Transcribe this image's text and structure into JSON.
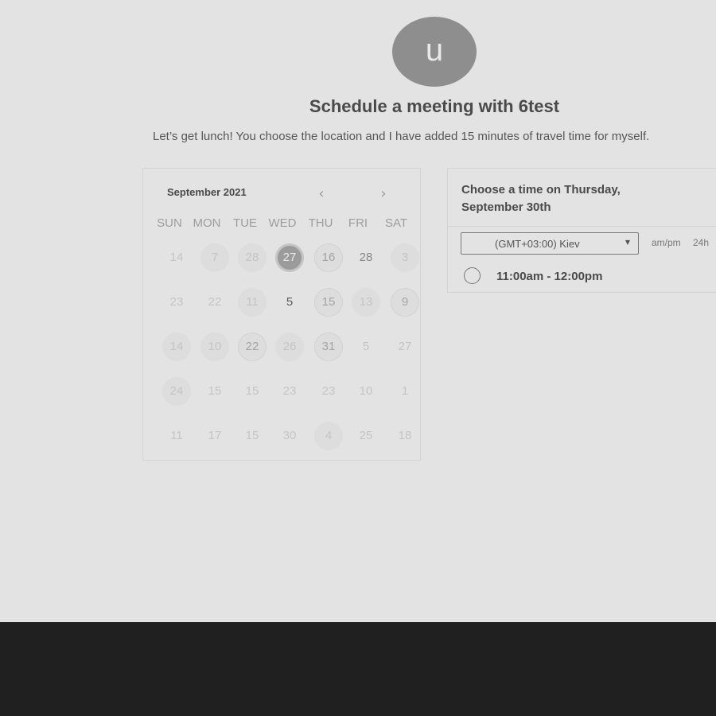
{
  "host": {
    "avatar_initial": "u"
  },
  "header": {
    "title": "Schedule a meeting with 6test",
    "subtitle": "Let’s get lunch! You choose the location and I have added 15 minutes of travel time for myself."
  },
  "calendar": {
    "month_label": "September 2021",
    "prev_icon": "‹",
    "next_icon": "›",
    "weekdays": [
      "SUN",
      "MON",
      "TUE",
      "WED",
      "THU",
      "FRI",
      "SAT"
    ],
    "weeks": [
      [
        "14",
        "7",
        "28",
        "27",
        "16",
        "28",
        "3"
      ],
      [
        "23",
        "22",
        "11",
        "5",
        "15",
        "13",
        "9"
      ],
      [
        "14",
        "10",
        "22",
        "26",
        "31",
        "5",
        "27"
      ],
      [
        "24",
        "15",
        "15",
        "23",
        "23",
        "10",
        "1"
      ],
      [
        "11",
        "17",
        "15",
        "30",
        "4",
        "25",
        "18"
      ]
    ],
    "selected": "27"
  },
  "times": {
    "heading": "Choose a time on Thursday, September 30th",
    "timezone": "(GMT+03:00) Kiev",
    "timezone_caret": "▼",
    "format_ampm": "am/pm",
    "format_24h": "24h",
    "slots": [
      "11:00am - 12:00pm"
    ]
  }
}
